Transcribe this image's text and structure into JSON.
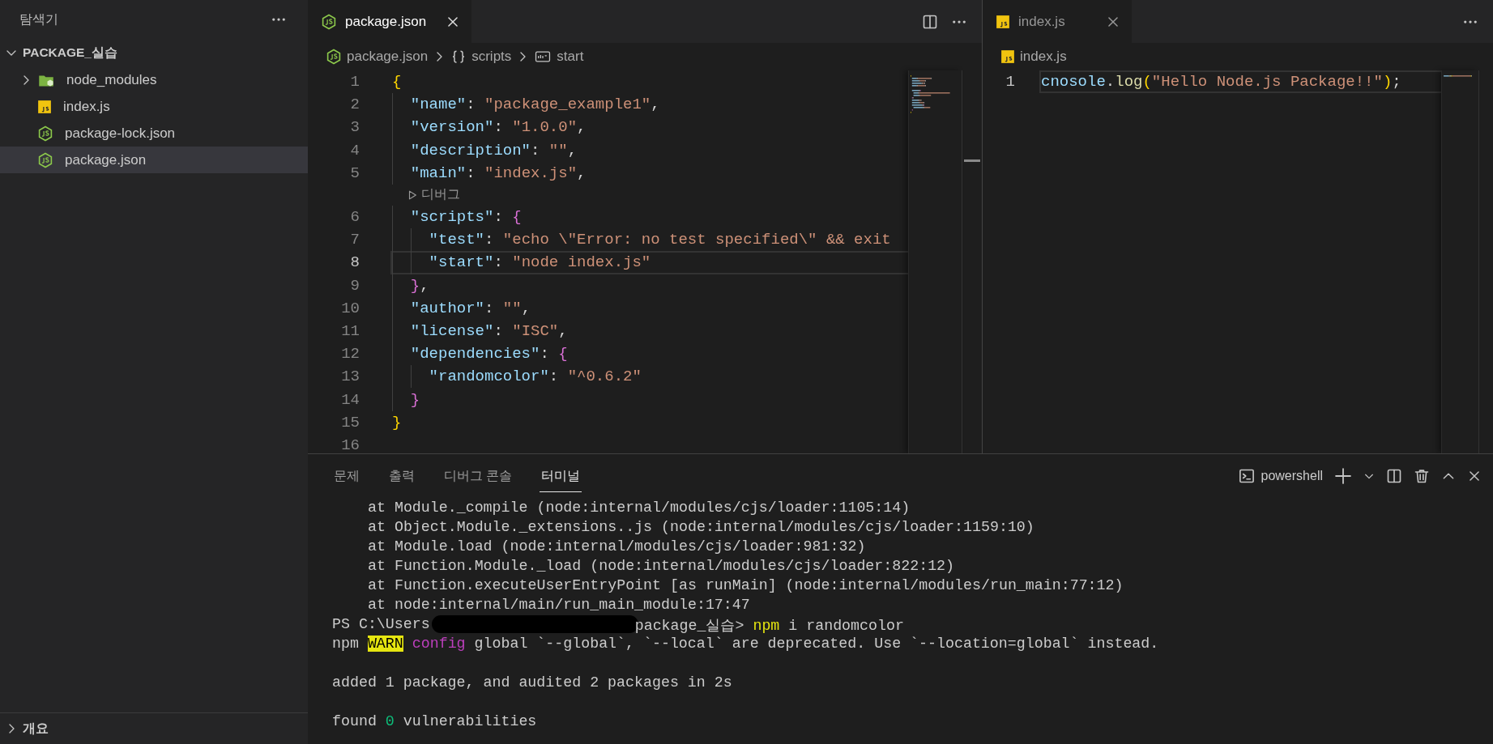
{
  "sidebar": {
    "title": "탐색기",
    "root": {
      "label": "PACKAGE_실습",
      "expanded": true,
      "children": [
        {
          "label": "node_modules",
          "kind": "folder",
          "expanded": false,
          "selected": false
        },
        {
          "label": "index.js",
          "kind": "js",
          "selected": false
        },
        {
          "label": "package-lock.json",
          "kind": "json",
          "selected": false
        },
        {
          "label": "package.json",
          "kind": "json",
          "selected": true
        }
      ]
    },
    "outline": {
      "label": "개요",
      "expanded": false
    }
  },
  "editor_groups": [
    {
      "focused": true,
      "tabs": [
        {
          "label": "package.json",
          "kind": "json",
          "selected": true
        }
      ],
      "actions": [
        {
          "kind": "split"
        },
        {
          "kind": "more"
        }
      ],
      "breadcrumbs": [
        {
          "label": "package.json",
          "kind": "json"
        },
        {
          "label": "scripts",
          "kind": "object"
        },
        {
          "label": "start",
          "kind": "string"
        }
      ],
      "lines": [
        {
          "kind": "code",
          "number": "1",
          "current": false,
          "tokens": [
            {
              "kind": "b1",
              "s": "{"
            }
          ]
        },
        {
          "kind": "code",
          "number": "2",
          "current": false,
          "tokens": [
            {
              "kind": "guide"
            },
            {
              "kind": "key",
              "s": "\"name\""
            },
            {
              "kind": "punct",
              "s": ": "
            },
            {
              "kind": "str",
              "s": "\"package_example1\""
            },
            {
              "kind": "punct",
              "s": ","
            }
          ]
        },
        {
          "kind": "code",
          "number": "3",
          "current": false,
          "tokens": [
            {
              "kind": "guide"
            },
            {
              "kind": "key",
              "s": "\"version\""
            },
            {
              "kind": "punct",
              "s": ": "
            },
            {
              "kind": "str",
              "s": "\"1.0.0\""
            },
            {
              "kind": "punct",
              "s": ","
            }
          ]
        },
        {
          "kind": "code",
          "number": "4",
          "current": false,
          "tokens": [
            {
              "kind": "guide"
            },
            {
              "kind": "key",
              "s": "\"description\""
            },
            {
              "kind": "punct",
              "s": ": "
            },
            {
              "kind": "str",
              "s": "\"\""
            },
            {
              "kind": "punct",
              "s": ","
            }
          ]
        },
        {
          "kind": "code",
          "number": "5",
          "current": false,
          "tokens": [
            {
              "kind": "guide"
            },
            {
              "kind": "key",
              "s": "\"main\""
            },
            {
              "kind": "punct",
              "s": ": "
            },
            {
              "kind": "str",
              "s": "\"index.js\""
            },
            {
              "kind": "punct",
              "s": ","
            }
          ]
        },
        {
          "kind": "lens",
          "text": "디버그"
        },
        {
          "kind": "code",
          "number": "6",
          "current": false,
          "tokens": [
            {
              "kind": "guide"
            },
            {
              "kind": "key",
              "s": "\"scripts\""
            },
            {
              "kind": "punct",
              "s": ": "
            },
            {
              "kind": "b2",
              "s": "{"
            }
          ]
        },
        {
          "kind": "code",
          "number": "7",
          "current": false,
          "tokens": [
            {
              "kind": "guide"
            },
            {
              "kind": "guide"
            },
            {
              "kind": "key",
              "s": "\"test\""
            },
            {
              "kind": "punct",
              "s": ": "
            },
            {
              "kind": "str",
              "s": "\"echo \\\"Error: no test specified\\\" && exit"
            }
          ]
        },
        {
          "kind": "code",
          "number": "8",
          "current": true,
          "tokens": [
            {
              "kind": "guide"
            },
            {
              "kind": "guide"
            },
            {
              "kind": "key",
              "s": "\"start\""
            },
            {
              "kind": "punct",
              "s": ": "
            },
            {
              "kind": "str",
              "s": "\"node index.js\""
            }
          ]
        },
        {
          "kind": "code",
          "number": "9",
          "current": false,
          "tokens": [
            {
              "kind": "guide"
            },
            {
              "kind": "b2",
              "s": "}"
            },
            {
              "kind": "punct",
              "s": ","
            }
          ]
        },
        {
          "kind": "code",
          "number": "10",
          "current": false,
          "tokens": [
            {
              "kind": "guide"
            },
            {
              "kind": "key",
              "s": "\"author\""
            },
            {
              "kind": "punct",
              "s": ": "
            },
            {
              "kind": "str",
              "s": "\"\""
            },
            {
              "kind": "punct",
              "s": ","
            }
          ]
        },
        {
          "kind": "code",
          "number": "11",
          "current": false,
          "tokens": [
            {
              "kind": "guide"
            },
            {
              "kind": "key",
              "s": "\"license\""
            },
            {
              "kind": "punct",
              "s": ": "
            },
            {
              "kind": "str",
              "s": "\"ISC\""
            },
            {
              "kind": "punct",
              "s": ","
            }
          ]
        },
        {
          "kind": "code",
          "number": "12",
          "current": false,
          "tokens": [
            {
              "kind": "guide"
            },
            {
              "kind": "key",
              "s": "\"dependencies\""
            },
            {
              "kind": "punct",
              "s": ": "
            },
            {
              "kind": "b2",
              "s": "{"
            }
          ]
        },
        {
          "kind": "code",
          "number": "13",
          "current": false,
          "tokens": [
            {
              "kind": "guide"
            },
            {
              "kind": "guide"
            },
            {
              "kind": "key",
              "s": "\"randomcolor\""
            },
            {
              "kind": "punct",
              "s": ": "
            },
            {
              "kind": "str",
              "s": "\"^0.6.2\""
            }
          ]
        },
        {
          "kind": "code",
          "number": "14",
          "current": false,
          "tokens": [
            {
              "kind": "guide"
            },
            {
              "kind": "b2",
              "s": "}"
            }
          ]
        },
        {
          "kind": "code",
          "number": "15",
          "current": false,
          "tokens": [
            {
              "kind": "b1",
              "s": "}"
            }
          ]
        },
        {
          "kind": "code",
          "number": "16",
          "current": false
        }
      ]
    },
    {
      "focused": false,
      "tabs": [
        {
          "label": "index.js",
          "kind": "js",
          "selected": true
        }
      ],
      "actions": [
        {
          "kind": "more"
        }
      ],
      "breadcrumbs": [
        {
          "label": "index.js",
          "kind": "js"
        }
      ],
      "lines": [
        {
          "kind": "code",
          "number": "1",
          "current": true,
          "tokens": [
            {
              "kind": "var",
              "s": "cnosole"
            },
            {
              "kind": "punct",
              "s": "."
            },
            {
              "kind": "fn",
              "s": "log"
            },
            {
              "kind": "b1",
              "s": "("
            },
            {
              "kind": "str",
              "s": "\"Hello Node.js Package!!\""
            },
            {
              "kind": "b1",
              "s": ")"
            },
            {
              "kind": "punct",
              "s": ";"
            }
          ]
        }
      ]
    }
  ],
  "panel": {
    "tabs": [
      {
        "label": "문제",
        "selected": false
      },
      {
        "label": "출력",
        "selected": false
      },
      {
        "label": "디버그 콘솔",
        "selected": false
      },
      {
        "label": "터미널",
        "selected": true
      }
    ],
    "shell": "powershell",
    "terminal": [
      {
        "kind": "trace",
        "segments": [
          {
            "kind": "plain",
            "s": "at Module._compile (node:internal/modules/cjs/loader:1105:14)"
          }
        ]
      },
      {
        "kind": "trace",
        "segments": [
          {
            "kind": "plain",
            "s": "at Object.Module._extensions..js (node:internal/modules/cjs/loader:1159:10)"
          }
        ]
      },
      {
        "kind": "trace",
        "segments": [
          {
            "kind": "plain",
            "s": "at Module.load (node:internal/modules/cjs/loader:981:32)"
          }
        ]
      },
      {
        "kind": "trace",
        "segments": [
          {
            "kind": "plain",
            "s": "at Function.Module._load (node:internal/modules/cjs/loader:822:12)"
          }
        ]
      },
      {
        "kind": "trace",
        "segments": [
          {
            "kind": "plain",
            "s": "at Function.executeUserEntryPoint [as runMain] (node:internal/modules/run_main:77:12)"
          }
        ]
      },
      {
        "kind": "trace",
        "segments": [
          {
            "kind": "plain",
            "s": "at node:internal/main/run_main_module:17:47"
          }
        ]
      },
      {
        "kind": "text",
        "segments": [
          {
            "kind": "plain",
            "s": "PS C:\\Users"
          },
          {
            "kind": "redacted"
          },
          {
            "kind": "plain",
            "s": "package_실습> "
          },
          {
            "kind": "cmd",
            "s": "npm"
          },
          {
            "kind": "plain",
            "s": " i randomcolor"
          }
        ]
      },
      {
        "kind": "text",
        "segments": [
          {
            "kind": "plain",
            "s": "npm "
          },
          {
            "kind": "warn",
            "s": "WARN"
          },
          {
            "kind": "keyword",
            "s": " config"
          },
          {
            "kind": "plain",
            "s": " global `--global`, `--local` are deprecated. Use `--location=global` instead."
          }
        ]
      },
      {
        "kind": "blank"
      },
      {
        "kind": "text",
        "segments": [
          {
            "kind": "plain",
            "s": "added 1 package, and audited 2 packages in 2s"
          }
        ]
      },
      {
        "kind": "blank"
      },
      {
        "kind": "text",
        "segments": [
          {
            "kind": "plain",
            "s": "found "
          },
          {
            "kind": "num",
            "s": "0"
          },
          {
            "kind": "plain",
            "s": " vulnerabilities"
          }
        ]
      }
    ]
  }
}
